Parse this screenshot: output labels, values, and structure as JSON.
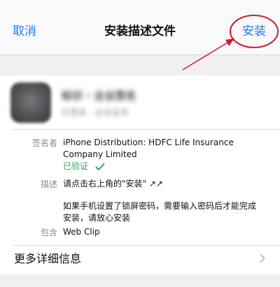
{
  "navbar": {
    "cancel_label": "取消",
    "title": "安装描述文件",
    "install_label": "安装"
  },
  "profile": {
    "name": "标识 - 企业签名",
    "subtitle": "已签名 · 企业证书"
  },
  "details": {
    "signer_label": "签名者",
    "signer_value": "iPhone Distribution: HDFC Life Insurance Company Limited",
    "verified_label": "已验证",
    "description_label": "描述",
    "description_line1": "请点击右上角的\"安装\" ↗↗",
    "description_line2": "如果手机设置了锁屏密码，需要输入密码后才能完成安装，请放心安装",
    "contains_label": "包含",
    "contains_value": "Web Clip"
  },
  "more": {
    "label": "更多详细信息"
  },
  "colors": {
    "accent": "#1f7cf5",
    "verified": "#34a853",
    "annotation": "#c8202a"
  },
  "icons": {
    "verified": "checkmark-icon",
    "more": "chevron-right-icon"
  }
}
